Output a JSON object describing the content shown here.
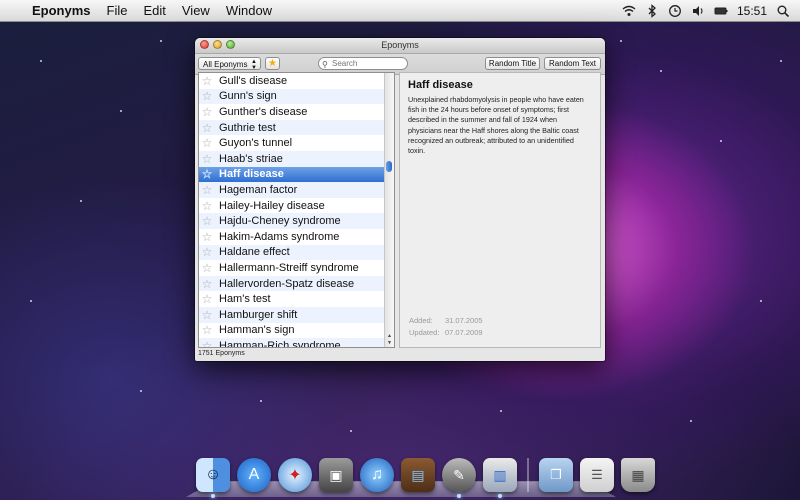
{
  "menubar": {
    "app_name": "Eponyms",
    "menus": [
      "File",
      "Edit",
      "View",
      "Window"
    ],
    "clock": "15:51"
  },
  "window": {
    "title": "Eponyms",
    "filter_select": "All Eponyms",
    "search_placeholder": "Search",
    "random_title_label": "Random Title",
    "random_text_label": "Random Text",
    "status": "1751 Eponyms"
  },
  "list": {
    "items": [
      "Gull's disease",
      "Gunn's sign",
      "Gunther's disease",
      "Guthrie test",
      "Guyon's tunnel",
      "Haab's striae",
      "Haff disease",
      "Hageman factor",
      "Hailey-Hailey disease",
      "Hajdu-Cheney syndrome",
      "Hakim-Adams syndrome",
      "Haldane effect",
      "Hallermann-Streiff syndrome",
      "Hallervorden-Spatz disease",
      "Ham's test",
      "Hamburger shift",
      "Hamman's sign",
      "Hamman-Rich syndrome"
    ],
    "selected_index": 6
  },
  "detail": {
    "title": "Haff disease",
    "text": "Unexplained rhabdomyolysis in people who have eaten fish in the 24 hours before onset of symptoms; first described in the summer and fall of 1924 when physicians near the Haff shores along the Baltic coast recognized an outbreak; attributed to an unidentified toxin.",
    "added_label": "Added:",
    "added_value": "31.07.2005",
    "updated_label": "Updated:",
    "updated_value": "07.07.2009"
  },
  "dock": {
    "icons": [
      "finder-icon",
      "app-store-icon",
      "safari-icon",
      "photo-booth-icon",
      "itunes-icon",
      "keynote-icon",
      "preview-icon",
      "eponyms-app-icon",
      "documents-folder-icon",
      "stack-icon",
      "trash-icon"
    ]
  },
  "colors": {
    "selection": "#3b76d6",
    "alt_row": "#edf3fe"
  }
}
